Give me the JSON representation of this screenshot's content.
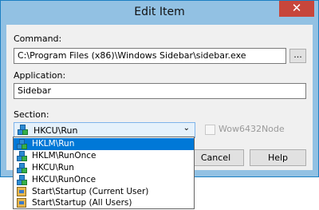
{
  "window": {
    "title": "Edit Item",
    "close_glyph": "✕"
  },
  "form": {
    "command_label": "Command:",
    "command_value": "C:\\Program Files (x86)\\Windows Sidebar\\sidebar.exe",
    "browse_label": "...",
    "application_label": "Application:",
    "application_value": "Sidebar",
    "section_label": "Section:",
    "section_value": "HKCU\\Run",
    "wow_label": "Wow6432Node",
    "wow_checked": false
  },
  "buttons": {
    "cancel": "Cancel",
    "help": "Help"
  },
  "dropdown": {
    "items": [
      {
        "label": "HKLM\\Run",
        "icon": "registry-icon",
        "selected": true
      },
      {
        "label": "HKLM\\RunOnce",
        "icon": "registry-icon",
        "selected": false
      },
      {
        "label": "HKCU\\Run",
        "icon": "registry-icon",
        "selected": false
      },
      {
        "label": "HKCU\\RunOnce",
        "icon": "registry-icon",
        "selected": false
      },
      {
        "label": "Start\\Startup (Current User)",
        "icon": "startup-folder-icon",
        "selected": false
      },
      {
        "label": "Start\\Startup (All Users)",
        "icon": "startup-folder-icon",
        "selected": false
      }
    ]
  },
  "colors": {
    "title_bar": "#92c1e3",
    "close_button": "#c7463b",
    "selection": "#0078d7"
  }
}
